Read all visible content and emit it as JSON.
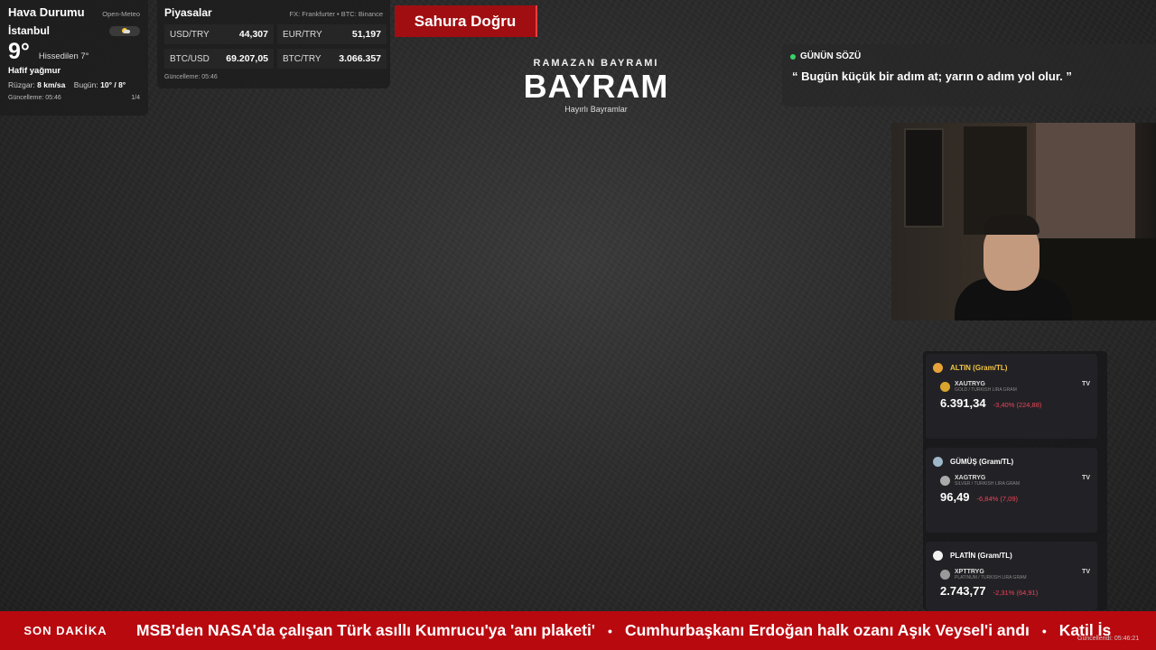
{
  "weather": {
    "title": "Hava Durumu",
    "source": "Open-Meteo",
    "city": "İstanbul",
    "temperature": "9°",
    "feels_like": "Hissedilen 7°",
    "condition": "Hafif yağmur",
    "wind_label": "Rüzgar:",
    "wind_value": "8 km/sa",
    "today_label": "Bugün:",
    "today_value": "10° / 8°",
    "updated": "Güncelleme: 05:46",
    "page": "1/4",
    "icon": "partly-cloudy-icon"
  },
  "markets": {
    "title": "Piyasalar",
    "source": "FX: Frankfurter • BTC: Binance",
    "items": [
      {
        "symbol": "USD/TRY",
        "value": "44,307"
      },
      {
        "symbol": "EUR/TRY",
        "value": "51,197"
      },
      {
        "symbol": "BTC/USD",
        "value": "69.207,05"
      },
      {
        "symbol": "BTC/TRY",
        "value": "3.066.357"
      }
    ],
    "updated": "Güncelleme: 05:46"
  },
  "sahur": {
    "label": "Sahura Doğru",
    "color": "#a10e12"
  },
  "center": {
    "small": "RAMAZAN BAYRAMI",
    "big": "BAYRAM",
    "sub": "Hayırlı Bayramlar"
  },
  "quote": {
    "label": "GÜNÜN SÖZÜ",
    "text": "“ Bugün küçük bir adım at; yarın o adım yol olur. ”"
  },
  "metals": [
    {
      "title": "ALTIN (Gram/TL)",
      "symbol": "XAUTRYG",
      "desc": "GOLD / TURKISH LIRA GRAM",
      "price": "6.391,34",
      "change": "-3,40% (224,88)",
      "tv": "TV"
    },
    {
      "title": "GÜMÜŞ (Gram/TL)",
      "symbol": "XAGTRYG",
      "desc": "SILVER / TURKISH LIRA GRAM",
      "price": "96,49",
      "change": "-6,84% (7,09)",
      "tv": "TV"
    },
    {
      "title": "PLATİN (Gram/TL)",
      "symbol": "XPTTRYG",
      "desc": "PLATINUM / TURKISH LIRA GRAM",
      "price": "2.743,77",
      "change": "-2,31% (64,91)",
      "tv": "TV"
    }
  ],
  "metals_updated": "Güncellendi: 05:46:21",
  "ticker": {
    "label": "SON DAKİKA",
    "items": [
      "MSB'den NASA'da çalışan Türk asıllı Kumrucu'ya 'anı plaketi'",
      "Cumhurbaşkanı Erdoğan halk ozanı Aşık Veysel'i andı",
      "Katil İs"
    ],
    "separator": "•"
  },
  "colors": {
    "ticker_bg": "#b8090f",
    "negative": "#f0435a",
    "accent_green": "#3ad26b",
    "gold": "#f4c542"
  }
}
